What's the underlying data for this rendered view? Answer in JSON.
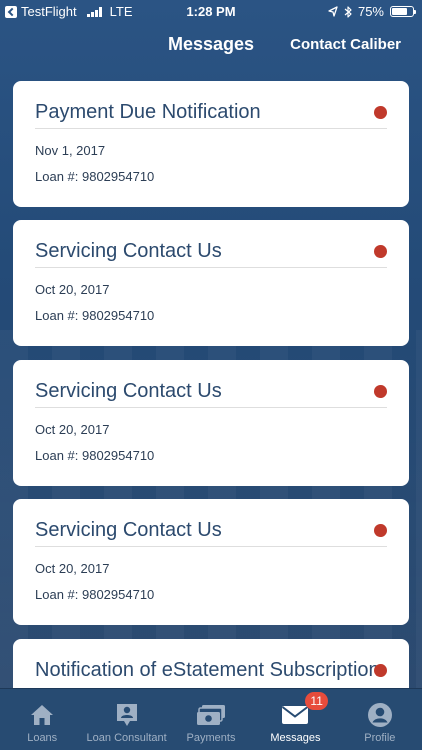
{
  "status_bar": {
    "carrier": "TestFlight",
    "network": "LTE",
    "time": "1:28 PM",
    "battery_percent": "75%",
    "battery_level": 0.75,
    "icons": [
      "back-arrow-icon",
      "signal-icon",
      "location-arrow-icon",
      "bluetooth-icon",
      "battery-icon"
    ]
  },
  "nav": {
    "title": "Messages",
    "action_label": "Contact Caliber"
  },
  "messages": [
    {
      "title": "Payment Due Notification",
      "date": "Nov 1, 2017",
      "loan": "Loan #: 9802954710",
      "unread": true
    },
    {
      "title": "Servicing Contact Us",
      "date": "Oct 20, 2017",
      "loan": "Loan #: 9802954710",
      "unread": true
    },
    {
      "title": "Servicing Contact Us",
      "date": "Oct 20, 2017",
      "loan": "Loan #: 9802954710",
      "unread": true
    },
    {
      "title": "Servicing Contact Us",
      "date": "Oct 20, 2017",
      "loan": "Loan #: 9802954710",
      "unread": true
    },
    {
      "title": "Notification of eStatement Subscription",
      "date": "",
      "loan": "",
      "unread": true
    }
  ],
  "tabs": [
    {
      "label": "Loans",
      "icon": "home-icon",
      "active": false
    },
    {
      "label": "Loan Consultant",
      "icon": "consultant-icon",
      "active": false
    },
    {
      "label": "Payments",
      "icon": "payments-icon",
      "active": false
    },
    {
      "label": "Messages",
      "icon": "envelope-icon",
      "active": true,
      "badge": "11"
    },
    {
      "label": "Profile",
      "icon": "profile-icon",
      "active": false
    }
  ],
  "colors": {
    "background": "#23466f",
    "card": "#ffffff",
    "title_text": "#2c4a6e",
    "unread_dot": "#c0392b",
    "badge": "#e74c3c",
    "tab_inactive": "#9fb0c4",
    "tab_active": "#ffffff"
  }
}
